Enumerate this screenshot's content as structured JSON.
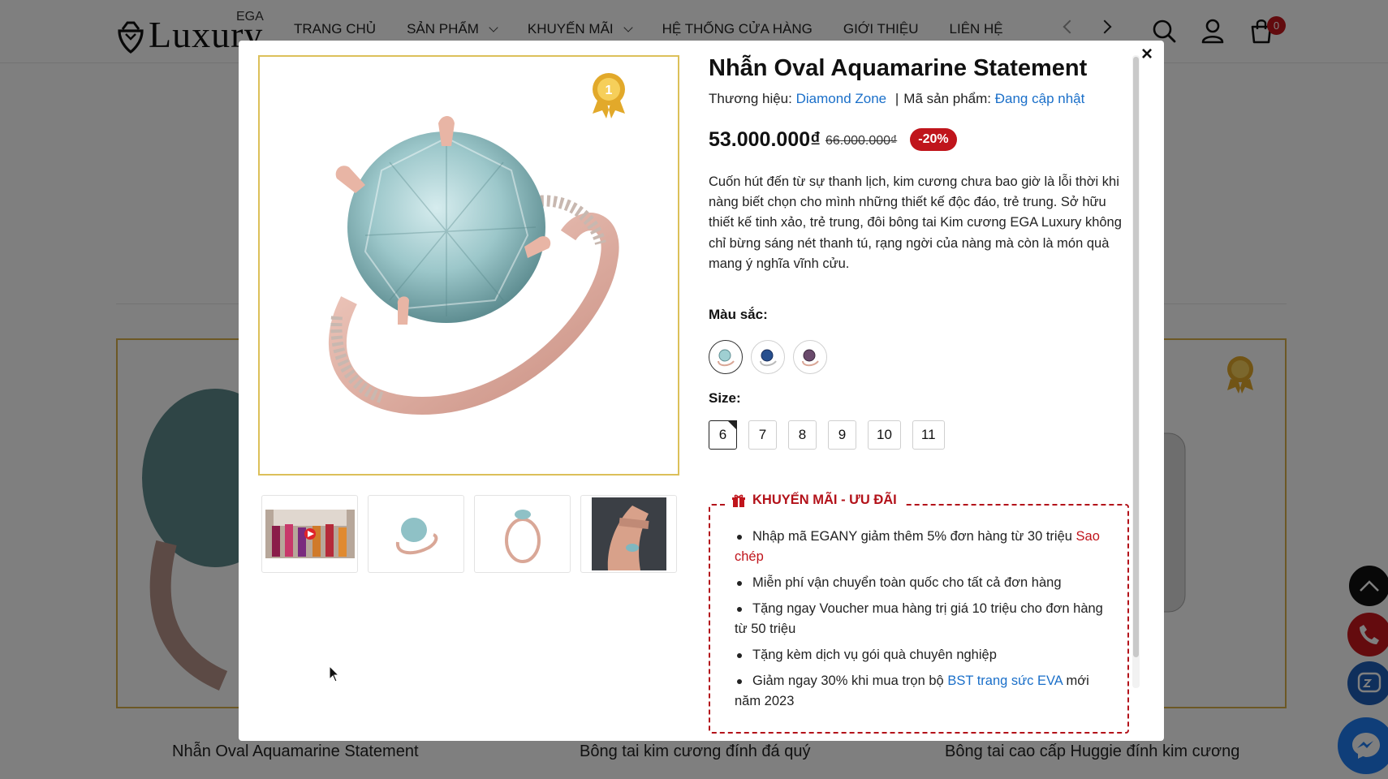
{
  "header": {
    "logo_text": "Luxury",
    "logo_sup": "EGA",
    "nav": [
      {
        "label": "TRANG CHỦ",
        "dropdown": false
      },
      {
        "label": "SẢN PHẨM",
        "dropdown": true
      },
      {
        "label": "KHUYẾN MÃI",
        "dropdown": true
      },
      {
        "label": "HỆ THỐNG CỬA HÀNG",
        "dropdown": false
      },
      {
        "label": "GIỚI THIỆU",
        "dropdown": false
      },
      {
        "label": "LIÊN HỆ",
        "dropdown": false
      }
    ],
    "cart_count": "0"
  },
  "background_cards": [
    {
      "title": "Nhẫn Oval Aquamarine Statement"
    },
    {
      "title": "Bông tai kim cương đính đá quý"
    },
    {
      "title": "Bông tai cao cấp Huggie đính kim cương"
    }
  ],
  "modal": {
    "close_label": "×",
    "title": "Nhẫn Oval Aquamarine Statement",
    "brand_label": "Thương hiệu:",
    "brand_value": "Diamond Zone",
    "separator": "|",
    "sku_label": "Mã sản phẩm:",
    "sku_value": "Đang cập nhật",
    "price": "53.000.000₫",
    "old_price": "66.000.000₫",
    "discount": "-20%",
    "description": "Cuốn hút đến từ sự thanh lịch, kim cương chưa bao giờ là lỗi thời khi nàng biết chọn cho mình những thiết kế độc đáo, trẻ trung. Sở hữu thiết kế tinh xảo, trẻ trung, đôi bông tai Kim cương EGA Luxury không chỉ bừng sáng nét thanh tú, rạng ngời của nàng mà còn là món quà mang ý nghĩa vĩnh cửu.",
    "color_label": "Màu sắc:",
    "colors": [
      {
        "name": "aquamarine",
        "hex": "#9fcfd2",
        "selected": true
      },
      {
        "name": "sapphire",
        "hex": "#274f8e",
        "selected": false
      },
      {
        "name": "amethyst",
        "hex": "#6a4a6c",
        "selected": false
      }
    ],
    "size_label": "Size:",
    "sizes": [
      {
        "label": "6",
        "selected": true
      },
      {
        "label": "7",
        "selected": false
      },
      {
        "label": "8",
        "selected": false
      },
      {
        "label": "9",
        "selected": false
      },
      {
        "label": "10",
        "selected": false
      },
      {
        "label": "11",
        "selected": false
      }
    ],
    "thumbnails": [
      "video-thumbnail",
      "ring-top-view",
      "ring-side-view",
      "ring-on-hand"
    ],
    "promo": {
      "title": "KHUYẾN MÃI - ƯU ĐÃI",
      "item1_text": "Nhập mã EGANY giảm thêm 5% đơn hàng từ 30 triệu",
      "item1_link": "Sao chép",
      "item2_text": "Miễn phí vận chuyển toàn quốc cho tất cả đơn hàng",
      "item3_text": "Tặng ngay Voucher mua hàng trị giá 10 triệu cho đơn hàng từ 50 triệu",
      "item4_text": "Tặng kèm dịch vụ gói quà chuyên nghiệp",
      "item5_pre": "Giảm ngay 30% khi mua trọn bộ",
      "item5_link": "BST trang sức EVA",
      "item5_post": "mới năm 2023"
    }
  },
  "colors": {
    "accent_red": "#c0151c",
    "link_blue": "#1a6fc9",
    "gold_border": "#dcc05a"
  }
}
